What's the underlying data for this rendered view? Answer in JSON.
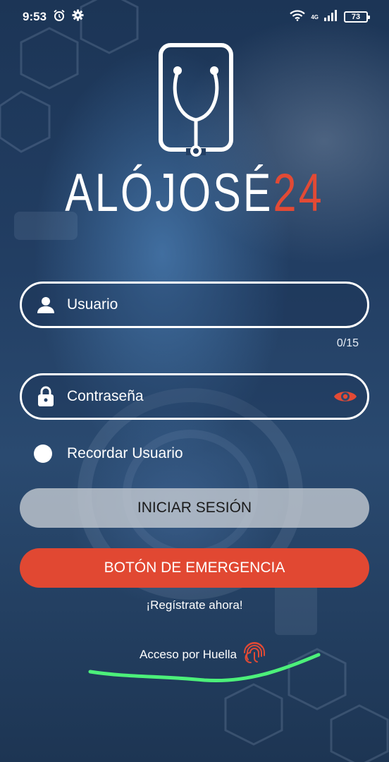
{
  "status_bar": {
    "time": "9:53",
    "network_type": "4G",
    "battery": "73",
    "icons": [
      "alarm-icon",
      "settings-icon",
      "wifi-icon",
      "signal-icon",
      "battery-icon"
    ]
  },
  "brand": {
    "name_main": "ALÓJOSÉ",
    "name_accent": "24",
    "accent_color": "#e24a35"
  },
  "login": {
    "username_placeholder": "Usuario",
    "username_counter": "0/15",
    "password_placeholder": "Contraseña",
    "remember_label": "Recordar Usuario",
    "login_button": "INICIAR SESIÓN",
    "emergency_button": "BOTÓN DE EMERGENCIA",
    "register_link": "¡Regístrate ahora!",
    "fingerprint_label": "Acceso por Huella"
  },
  "colors": {
    "emergency": "#e14832",
    "eye_icon": "#e24a35",
    "highlight_underline": "#4cf07a"
  }
}
